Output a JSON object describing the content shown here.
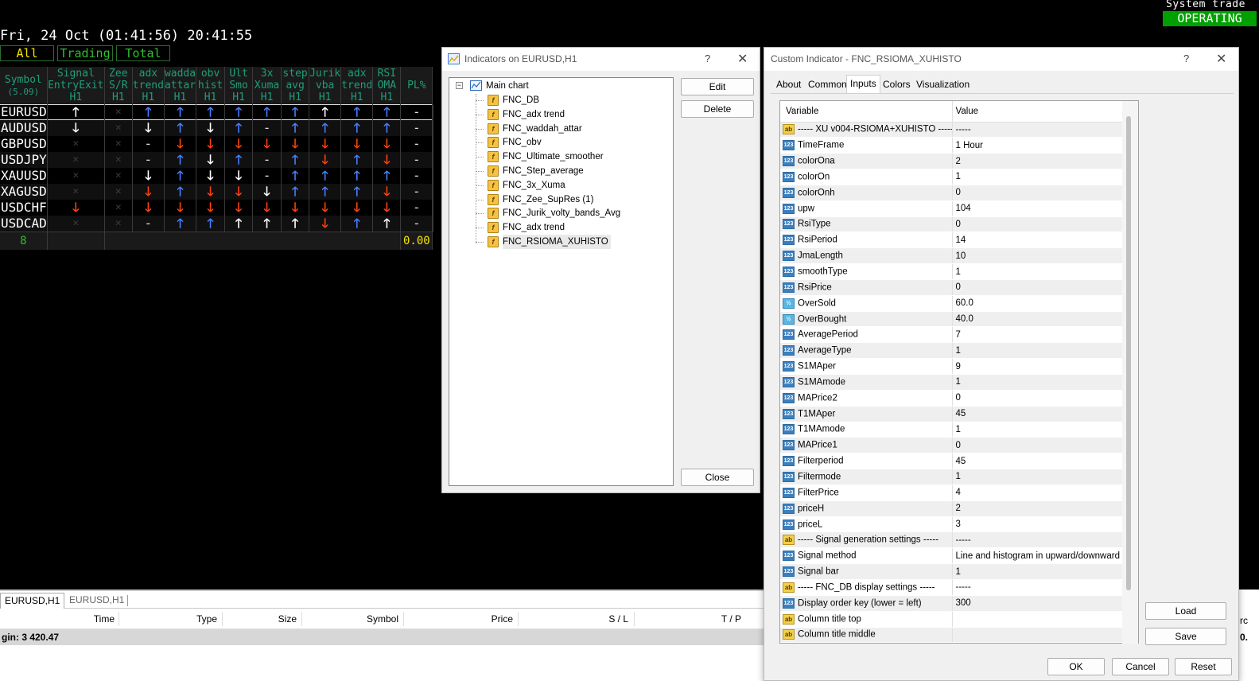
{
  "system": {
    "label": "System trade",
    "status": "OPERATING"
  },
  "clock": "Fri, 24 Oct (01:41:56) 20:41:55",
  "filter_tabs": [
    "All",
    "Trading",
    "Total"
  ],
  "grid": {
    "headers": [
      {
        "l1": "Symbol",
        "l2": "(5.09)"
      },
      {
        "l1": "Signal",
        "l2": "EntryExit",
        "l3": "H1"
      },
      {
        "l1": "Zee",
        "l2": "S/R",
        "l3": "H1"
      },
      {
        "l1": "adx",
        "l2": "trend",
        "l3": "H1"
      },
      {
        "l1": "wadda",
        "l2": "attar",
        "l3": "H1"
      },
      {
        "l1": "obv",
        "l2": "hist",
        "l3": "H1"
      },
      {
        "l1": "Ult",
        "l2": "Smo",
        "l3": "H1"
      },
      {
        "l1": "3x",
        "l2": "Xuma",
        "l3": "H1"
      },
      {
        "l1": "step",
        "l2": "avg",
        "l3": "H1"
      },
      {
        "l1": "Jurik",
        "l2": "vba",
        "l3": "H1"
      },
      {
        "l1": "adx",
        "l2": "trend",
        "l3": "H1"
      },
      {
        "l1": "RSI",
        "l2": "OMA",
        "l3": "H1"
      },
      {
        "l1": "PL%",
        "l2": "",
        "l3": ""
      }
    ],
    "rows": [
      {
        "symbol": "EURUSD",
        "cells": [
          "uw",
          "x",
          "ub",
          "ub",
          "ub",
          "ub",
          "ub",
          "ub",
          "uw",
          "ub",
          "ub",
          "-",
          ""
        ]
      },
      {
        "symbol": "AUDUSD",
        "cells": [
          "dw",
          "x",
          "dw",
          "ub",
          "dw",
          "ub",
          "-",
          "ub",
          "ub",
          "ub",
          "ub",
          "-",
          ""
        ]
      },
      {
        "symbol": "GBPUSD",
        "cells": [
          "x",
          "x",
          "-",
          "dr",
          "dr",
          "dr",
          "dr",
          "dr",
          "dr",
          "dr",
          "dr",
          "-",
          ""
        ]
      },
      {
        "symbol": "USDJPY",
        "cells": [
          "x",
          "x",
          "-",
          "ub",
          "dw",
          "ub",
          "-",
          "ub",
          "dr",
          "ub",
          "dr",
          "-",
          ""
        ]
      },
      {
        "symbol": "XAUUSD",
        "cells": [
          "x",
          "x",
          "dw",
          "ub",
          "dw",
          "dw",
          "-",
          "ub",
          "ub",
          "ub",
          "ub",
          "-",
          ""
        ]
      },
      {
        "symbol": "XAGUSD",
        "cells": [
          "x",
          "x",
          "dr",
          "ub",
          "dr",
          "dr",
          "dw",
          "ub",
          "ub",
          "ub",
          "dr",
          "-",
          ""
        ]
      },
      {
        "symbol": "USDCHF",
        "cells": [
          "dr",
          "x",
          "dr",
          "dr",
          "dr",
          "dr",
          "dr",
          "dr",
          "dr",
          "dr",
          "dr",
          "-",
          ""
        ]
      },
      {
        "symbol": "USDCAD",
        "cells": [
          "x",
          "x",
          "-",
          "ub",
          "ub",
          "uw",
          "uw",
          "uw",
          "dr",
          "ub",
          "uw",
          "-",
          ""
        ]
      }
    ],
    "footer_count": "8",
    "footer_pl": "0.00"
  },
  "terminal": {
    "tabs": [
      "EURUSD,H1",
      "EURUSD,H1"
    ],
    "columns": [
      "Time",
      "Type",
      "Size",
      "Symbol",
      "Price",
      "S / L",
      "T / P"
    ],
    "margin": "gin: 3 420.47",
    "right_fragments": [
      "rc",
      "0."
    ]
  },
  "indicators_dialog": {
    "title": "Indicators on EURUSD,H1",
    "help": "?",
    "root": "Main chart",
    "items": [
      "FNC_DB",
      "FNC_adx trend",
      "FNC_waddah_attar",
      "FNC_obv",
      "FNC_Ultimate_smoother",
      "FNC_Step_average",
      "FNC_3x_Xuma",
      "FNC_Zee_SupRes (1)",
      "FNC_Jurik_volty_bands_Avg",
      "FNC_adx trend",
      "FNC_RSIOMA_XUHISTO"
    ],
    "buttons": {
      "edit": "Edit",
      "delete": "Delete",
      "close": "Close"
    }
  },
  "custom_dialog": {
    "title": "Custom Indicator - FNC_RSIOMA_XUHISTO",
    "help": "?",
    "tabs": [
      "About",
      "Common",
      "Inputs",
      "Colors",
      "Visualization"
    ],
    "active_tab": "Inputs",
    "col_variable": "Variable",
    "col_value": "Value",
    "params": [
      {
        "t": "ab",
        "name": "----- XU v004-RSIOMA+XUHISTO -----",
        "value": "-----"
      },
      {
        "t": "123",
        "name": "TimeFrame",
        "value": "1 Hour"
      },
      {
        "t": "123",
        "name": "colorOna",
        "value": "2"
      },
      {
        "t": "123",
        "name": "colorOn",
        "value": "1"
      },
      {
        "t": "123",
        "name": "colorOnh",
        "value": "0"
      },
      {
        "t": "123",
        "name": "upw",
        "value": "104"
      },
      {
        "t": "123",
        "name": "RsiType",
        "value": "0"
      },
      {
        "t": "123",
        "name": "RsiPeriod",
        "value": "14"
      },
      {
        "t": "123",
        "name": "JmaLength",
        "value": "10"
      },
      {
        "t": "123",
        "name": "smoothType",
        "value": "1"
      },
      {
        "t": "123",
        "name": "RsiPrice",
        "value": "0"
      },
      {
        "t": "1/2",
        "name": "OverSold",
        "value": "60.0"
      },
      {
        "t": "1/2",
        "name": "OverBought",
        "value": "40.0"
      },
      {
        "t": "123",
        "name": "AveragePeriod",
        "value": "7"
      },
      {
        "t": "123",
        "name": "AverageType",
        "value": "1"
      },
      {
        "t": "123",
        "name": "S1MAper",
        "value": "9"
      },
      {
        "t": "123",
        "name": "S1MAmode",
        "value": "1"
      },
      {
        "t": "123",
        "name": "MAPrice2",
        "value": "0"
      },
      {
        "t": "123",
        "name": "T1MAper",
        "value": "45"
      },
      {
        "t": "123",
        "name": "T1MAmode",
        "value": "1"
      },
      {
        "t": "123",
        "name": "MAPrice1",
        "value": "0"
      },
      {
        "t": "123",
        "name": "Filterperiod",
        "value": "45"
      },
      {
        "t": "123",
        "name": "Filtermode",
        "value": "1"
      },
      {
        "t": "123",
        "name": "FilterPrice",
        "value": "4"
      },
      {
        "t": "123",
        "name": "priceH",
        "value": "2"
      },
      {
        "t": "123",
        "name": "priceL",
        "value": "3"
      },
      {
        "t": "ab",
        "name": "----- Signal generation settings -----",
        "value": "-----"
      },
      {
        "t": "123",
        "name": "Signal method",
        "value": "Line and histogram in upward/downward c..."
      },
      {
        "t": "123",
        "name": "Signal bar",
        "value": "1"
      },
      {
        "t": "ab",
        "name": "----- FNC_DB display settings -----",
        "value": "-----"
      },
      {
        "t": "123",
        "name": "Display order key (lower = left)",
        "value": "300"
      },
      {
        "t": "ab",
        "name": "Column title top",
        "value": ""
      },
      {
        "t": "ab",
        "name": "Column title middle",
        "value": ""
      }
    ],
    "buttons": {
      "load": "Load",
      "save": "Save",
      "ok": "OK",
      "cancel": "Cancel",
      "reset": "Reset"
    }
  },
  "colors": {
    "status_green": "#00a000",
    "up_blue": "#4a7dff",
    "down_red": "#ff4010",
    "header_teal": "#1f9e7a"
  }
}
